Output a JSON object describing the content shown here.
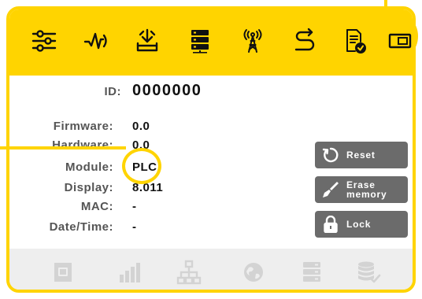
{
  "toolbar": {
    "icons": [
      "sliders-icon",
      "pulse-icon",
      "download-tray-icon",
      "server-icon",
      "antenna-tower-icon",
      "route-icon",
      "report-check-icon",
      "card-icon"
    ]
  },
  "device": {
    "id_label": "ID:",
    "id_value": "0000000",
    "fields": [
      {
        "label": "Firmware:",
        "value": "0.0"
      },
      {
        "label": "Hardware:",
        "value": "0.0"
      },
      {
        "label": "Module:",
        "value": "PLC"
      },
      {
        "label": "Display:",
        "value": "8.011"
      },
      {
        "label": "MAC:",
        "value": "-"
      },
      {
        "label": "Date/Time:",
        "value": "-"
      }
    ]
  },
  "actions": {
    "reset": "Reset",
    "erase_line1": "Erase",
    "erase_line2": "memory",
    "lock": "Lock"
  },
  "status": {
    "icons": [
      "sim-card-icon",
      "signal-bars-icon",
      "network-icon",
      "globe-icon",
      "server-stack-icon",
      "database-check-icon"
    ]
  },
  "colors": {
    "accent": "#ffd400",
    "button": "#6b6b6b",
    "status_bg": "#eeeeee",
    "status_icon": "#d3d3d3"
  }
}
